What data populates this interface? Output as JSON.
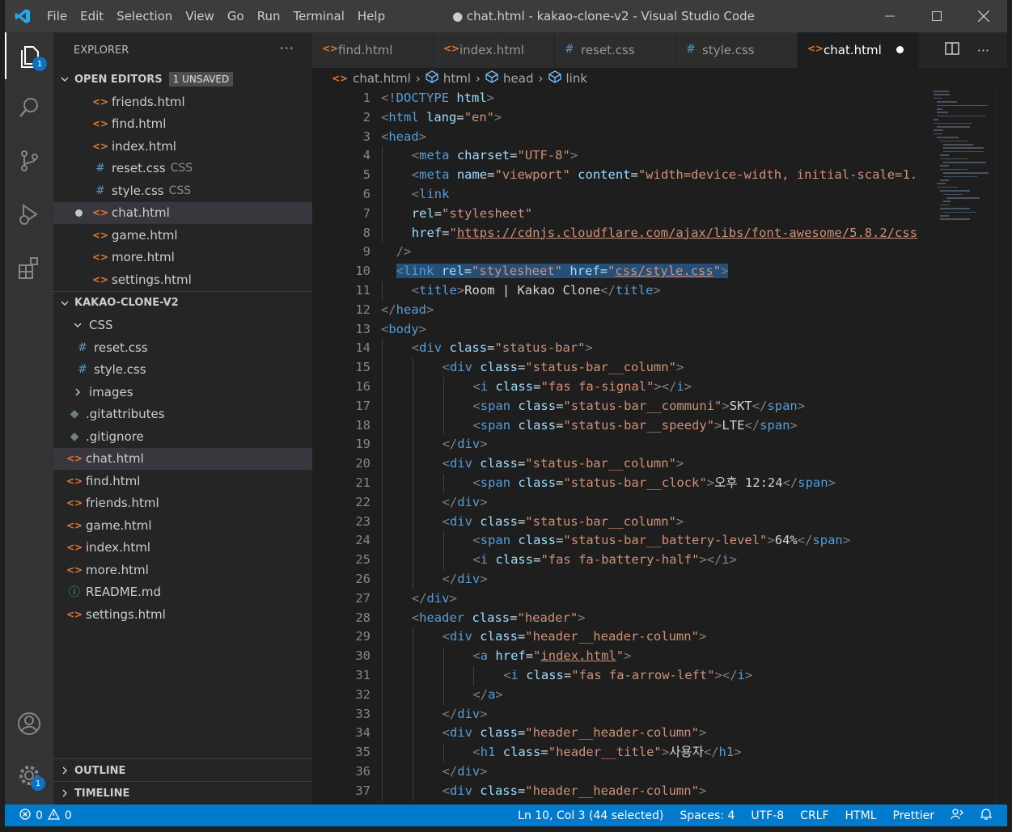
{
  "titlebar": {
    "menu": [
      "File",
      "Edit",
      "Selection",
      "View",
      "Go",
      "Run",
      "Terminal",
      "Help"
    ],
    "title": "● chat.html - kakao-clone-v2 - Visual Studio Code"
  },
  "activity": {
    "explorer_badge": "1",
    "settings_badge": "1"
  },
  "sidebar": {
    "header": "EXPLORER",
    "open_editors": {
      "label": "OPEN EDITORS",
      "badge": "1 UNSAVED",
      "items": [
        {
          "name": "friends.html",
          "type": "html",
          "desc": ""
        },
        {
          "name": "find.html",
          "type": "html",
          "desc": ""
        },
        {
          "name": "index.html",
          "type": "html",
          "desc": ""
        },
        {
          "name": "reset.css",
          "type": "css",
          "desc": "CSS"
        },
        {
          "name": "style.css",
          "type": "css",
          "desc": "CSS"
        },
        {
          "name": "chat.html",
          "type": "html",
          "desc": ""
        },
        {
          "name": "game.html",
          "type": "html",
          "desc": ""
        },
        {
          "name": "more.html",
          "type": "html",
          "desc": ""
        },
        {
          "name": "settings.html",
          "type": "html",
          "desc": ""
        }
      ]
    },
    "project": {
      "label": "KAKAO-CLONE-V2",
      "css_folder": "CSS",
      "css_items": [
        "reset.css",
        "style.css"
      ],
      "images_folder": "images",
      "files": [
        {
          "name": ".gitattributes",
          "type": "git"
        },
        {
          "name": ".gitignore",
          "type": "git"
        },
        {
          "name": "chat.html",
          "type": "html"
        },
        {
          "name": "find.html",
          "type": "html"
        },
        {
          "name": "friends.html",
          "type": "html"
        },
        {
          "name": "game.html",
          "type": "html"
        },
        {
          "name": "index.html",
          "type": "html"
        },
        {
          "name": "more.html",
          "type": "html"
        },
        {
          "name": "README.md",
          "type": "info"
        },
        {
          "name": "settings.html",
          "type": "html"
        }
      ]
    },
    "outline": "OUTLINE",
    "timeline": "TIMELINE"
  },
  "tabs": [
    {
      "label": "find.html",
      "type": "html"
    },
    {
      "label": "index.html",
      "type": "html"
    },
    {
      "label": "reset.css",
      "type": "css"
    },
    {
      "label": "style.css",
      "type": "css"
    },
    {
      "label": "chat.html",
      "type": "html"
    }
  ],
  "breadcrumb": [
    "chat.html",
    "html",
    "head",
    "link"
  ],
  "code_lines": [
    {
      "n": "1",
      "i": 0,
      "h": "<span class=p>&lt;!</span><span class=t>DOCTYPE</span> <span class=a>html</span><span class=p>&gt;</span>"
    },
    {
      "n": "2",
      "i": 0,
      "h": "<span class=p>&lt;</span><span class=t>html</span> <span class=a>lang</span>=<span class=s>\"en\"</span><span class=p>&gt;</span>"
    },
    {
      "n": "3",
      "i": 0,
      "h": "<span class=p>&lt;</span><span class=t>head</span><span class=p>&gt;</span>"
    },
    {
      "n": "4",
      "i": 1,
      "h": "<span class=p>&lt;</span><span class=t>meta</span> <span class=a>charset</span>=<span class=s>\"UTF-8\"</span><span class=p>&gt;</span>"
    },
    {
      "n": "5",
      "i": 1,
      "h": "<span class=p>&lt;</span><span class=t>meta</span> <span class=a>name</span>=<span class=s>\"viewport\"</span> <span class=a>content</span>=<span class=s>\"width=device-width, initial-scale=1.</span>"
    },
    {
      "n": "6",
      "i": 1,
      "h": "<span class=p>&lt;</span><span class=t>link</span>"
    },
    {
      "n": "7",
      "i": 1,
      "h": "<span class=a>rel</span>=<span class=s>\"stylesheet\"</span>"
    },
    {
      "n": "8",
      "i": 1,
      "h": "<span class=a>href</span>=<span class=s>\"</span><span class=u>https://cdnjs.cloudflare.com/ajax/libs/font-awesome/5.8.2/css</span>"
    },
    {
      "n": "9",
      "i": 0,
      "h": "  <span class=p>/&gt;</span>"
    },
    {
      "n": "10",
      "i": 0,
      "h": "  <span class=hl><span class=p>&lt;</span><span class=t>link</span> <span class=a>rel</span>=<span class=s>\"stylesheet\"</span> <span class=a>href</span>=<span class=s>\"</span><span class=u>css/style.css</span><span class=s>\"</span><span class=p>&gt;</span></span>"
    },
    {
      "n": "11",
      "i": 1,
      "h": "<span class=p>&lt;</span><span class=t>title</span><span class=p>&gt;</span>Room | Kakao Clone<span class=p>&lt;/</span><span class=t>title</span><span class=p>&gt;</span>"
    },
    {
      "n": "12",
      "i": 0,
      "h": "<span class=p>&lt;/</span><span class=t>head</span><span class=p>&gt;</span>"
    },
    {
      "n": "13",
      "i": 0,
      "h": "<span class=p>&lt;</span><span class=t>body</span><span class=p>&gt;</span>"
    },
    {
      "n": "14",
      "i": 1,
      "h": "<span class=p>&lt;</span><span class=t>div</span> <span class=a>class</span>=<span class=s>\"status-bar\"</span><span class=p>&gt;</span>"
    },
    {
      "n": "15",
      "i": 2,
      "h": "<span class=p>&lt;</span><span class=t>div</span> <span class=a>class</span>=<span class=s>\"status-bar__column\"</span><span class=p>&gt;</span>"
    },
    {
      "n": "16",
      "i": 3,
      "h": "<span class=p>&lt;</span><span class=t>i</span> <span class=a>class</span>=<span class=s>\"fas fa-signal\"</span><span class=p>&gt;&lt;/</span><span class=t>i</span><span class=p>&gt;</span>"
    },
    {
      "n": "17",
      "i": 3,
      "h": "<span class=p>&lt;</span><span class=t>span</span> <span class=a>class</span>=<span class=s>\"status-bar__communi\"</span><span class=p>&gt;</span>SKT<span class=p>&lt;/</span><span class=t>span</span><span class=p>&gt;</span>"
    },
    {
      "n": "18",
      "i": 3,
      "h": "<span class=p>&lt;</span><span class=t>span</span> <span class=a>class</span>=<span class=s>\"status-bar__speedy\"</span><span class=p>&gt;</span>LTE<span class=p>&lt;/</span><span class=t>span</span><span class=p>&gt;</span>"
    },
    {
      "n": "19",
      "i": 2,
      "h": "<span class=p>&lt;/</span><span class=t>div</span><span class=p>&gt;</span>"
    },
    {
      "n": "20",
      "i": 2,
      "h": "<span class=p>&lt;</span><span class=t>div</span> <span class=a>class</span>=<span class=s>\"status-bar__column\"</span><span class=p>&gt;</span>"
    },
    {
      "n": "21",
      "i": 3,
      "h": "<span class=p>&lt;</span><span class=t>span</span> <span class=a>class</span>=<span class=s>\"status-bar__clock\"</span><span class=p>&gt;</span>오후 12:24<span class=p>&lt;/</span><span class=t>span</span><span class=p>&gt;</span>"
    },
    {
      "n": "22",
      "i": 2,
      "h": "<span class=p>&lt;/</span><span class=t>div</span><span class=p>&gt;</span>"
    },
    {
      "n": "23",
      "i": 2,
      "h": "<span class=p>&lt;</span><span class=t>div</span> <span class=a>class</span>=<span class=s>\"status-bar__column\"</span><span class=p>&gt;</span>"
    },
    {
      "n": "24",
      "i": 3,
      "h": "<span class=p>&lt;</span><span class=t>span</span> <span class=a>class</span>=<span class=s>\"status-bar__battery-level\"</span><span class=p>&gt;</span>64%<span class=p>&lt;/</span><span class=t>span</span><span class=p>&gt;</span>"
    },
    {
      "n": "25",
      "i": 3,
      "h": "<span class=p>&lt;</span><span class=t>i</span> <span class=a>class</span>=<span class=s>\"fas fa-battery-half\"</span><span class=p>&gt;&lt;/</span><span class=t>i</span><span class=p>&gt;</span>"
    },
    {
      "n": "26",
      "i": 2,
      "h": "<span class=p>&lt;/</span><span class=t>div</span><span class=p>&gt;</span>"
    },
    {
      "n": "27",
      "i": 1,
      "h": "<span class=p>&lt;/</span><span class=t>div</span><span class=p>&gt;</span>"
    },
    {
      "n": "28",
      "i": 1,
      "h": "<span class=p>&lt;</span><span class=t>header</span> <span class=a>class</span>=<span class=s>\"header\"</span><span class=p>&gt;</span>"
    },
    {
      "n": "29",
      "i": 2,
      "h": "<span class=p>&lt;</span><span class=t>div</span> <span class=a>class</span>=<span class=s>\"header__header-column\"</span><span class=p>&gt;</span>"
    },
    {
      "n": "30",
      "i": 3,
      "h": "<span class=p>&lt;</span><span class=t>a</span> <span class=a>href</span>=<span class=s>\"</span><span class=u>index.html</span><span class=s>\"</span><span class=p>&gt;</span>"
    },
    {
      "n": "31",
      "i": 4,
      "h": "<span class=p>&lt;</span><span class=t>i</span> <span class=a>class</span>=<span class=s>\"fas fa-arrow-left\"</span><span class=p>&gt;&lt;/</span><span class=t>i</span><span class=p>&gt;</span>"
    },
    {
      "n": "32",
      "i": 3,
      "h": "<span class=p>&lt;/</span><span class=t>a</span><span class=p>&gt;</span>"
    },
    {
      "n": "33",
      "i": 2,
      "h": "<span class=p>&lt;/</span><span class=t>div</span><span class=p>&gt;</span>"
    },
    {
      "n": "34",
      "i": 2,
      "h": "<span class=p>&lt;</span><span class=t>div</span> <span class=a>class</span>=<span class=s>\"header__header-column\"</span><span class=p>&gt;</span>"
    },
    {
      "n": "35",
      "i": 3,
      "h": "<span class=p>&lt;</span><span class=t>h1</span> <span class=a>class</span>=<span class=s>\"header__title\"</span><span class=p>&gt;</span>사용자<span class=p>&lt;/</span><span class=t>h1</span><span class=p>&gt;</span>"
    },
    {
      "n": "36",
      "i": 2,
      "h": "<span class=p>&lt;/</span><span class=t>div</span><span class=p>&gt;</span>"
    },
    {
      "n": "37",
      "i": 2,
      "h": "<span class=p>&lt;</span><span class=t>div</span> <span class=a>class</span>=<span class=s>\"header__header-column\"</span><span class=p>&gt;</span>"
    }
  ],
  "status": {
    "errors": "0",
    "warnings": "0",
    "position": "Ln 10, Col 3 (44 selected)",
    "spaces": "Spaces: 4",
    "encoding": "UTF-8",
    "eol": "CRLF",
    "language": "HTML",
    "formatter": "Prettier"
  },
  "colors": {
    "accent": "#007acc",
    "html_icon": "#e37933",
    "css_icon": "#519aba"
  }
}
